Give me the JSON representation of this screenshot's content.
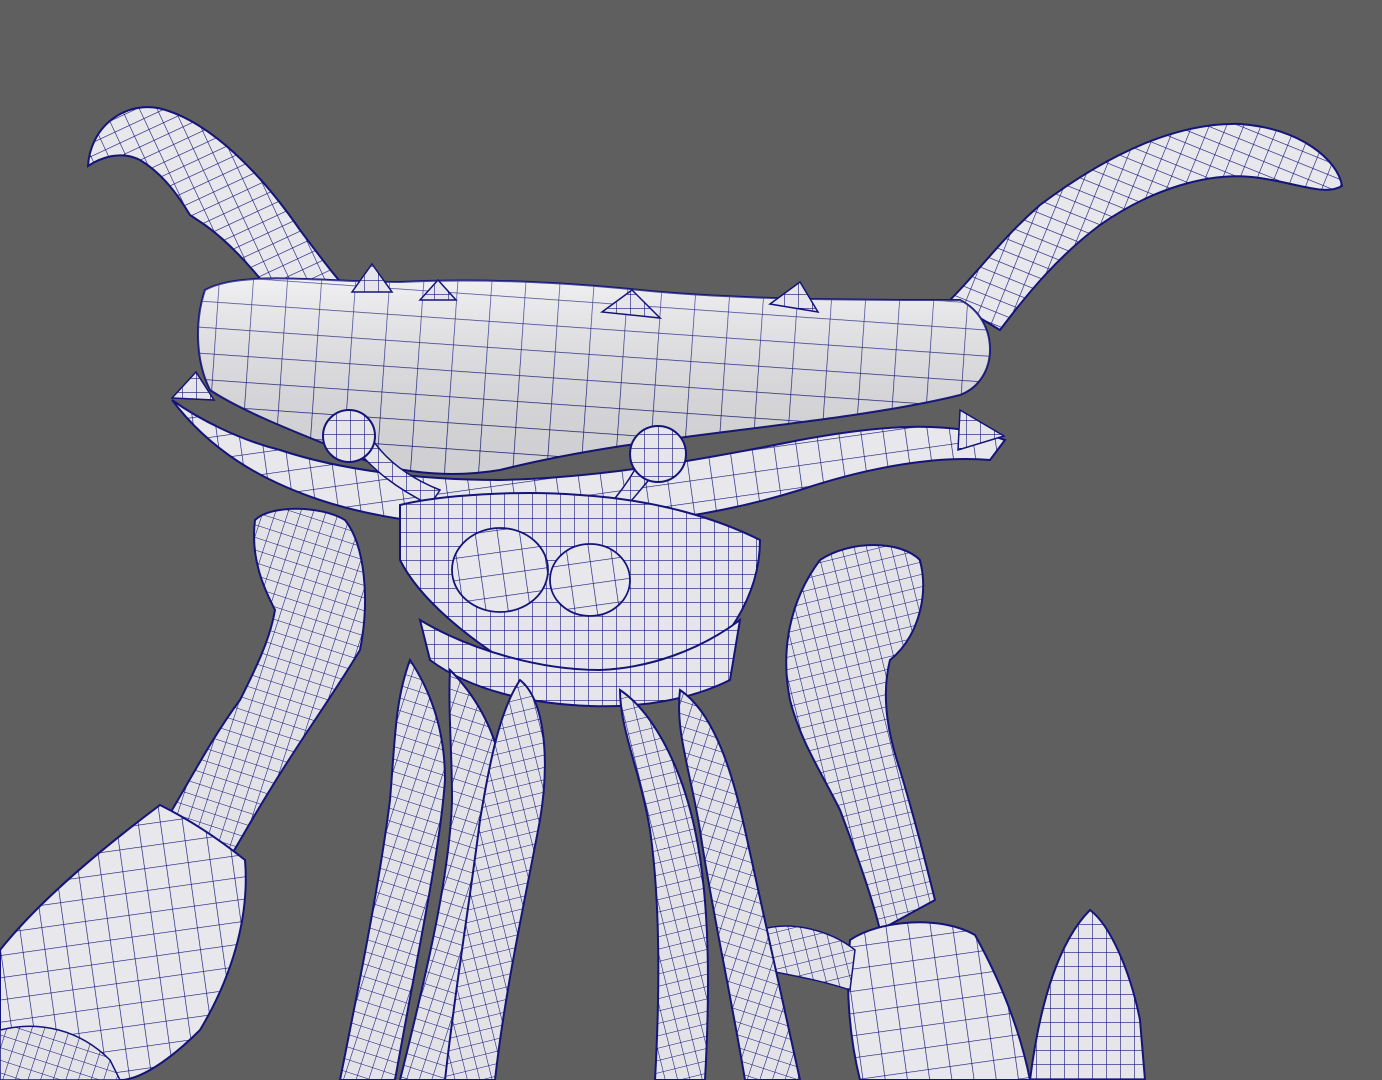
{
  "viewport": {
    "background_color": "#5f5f5f",
    "display_mode": "wireshaded",
    "subject": "crab-creature-model"
  },
  "colors": {
    "mesh_fill": "#e4e4e8",
    "mesh_shade": "#c9c9d0",
    "wire": "#14147a"
  },
  "icons": []
}
